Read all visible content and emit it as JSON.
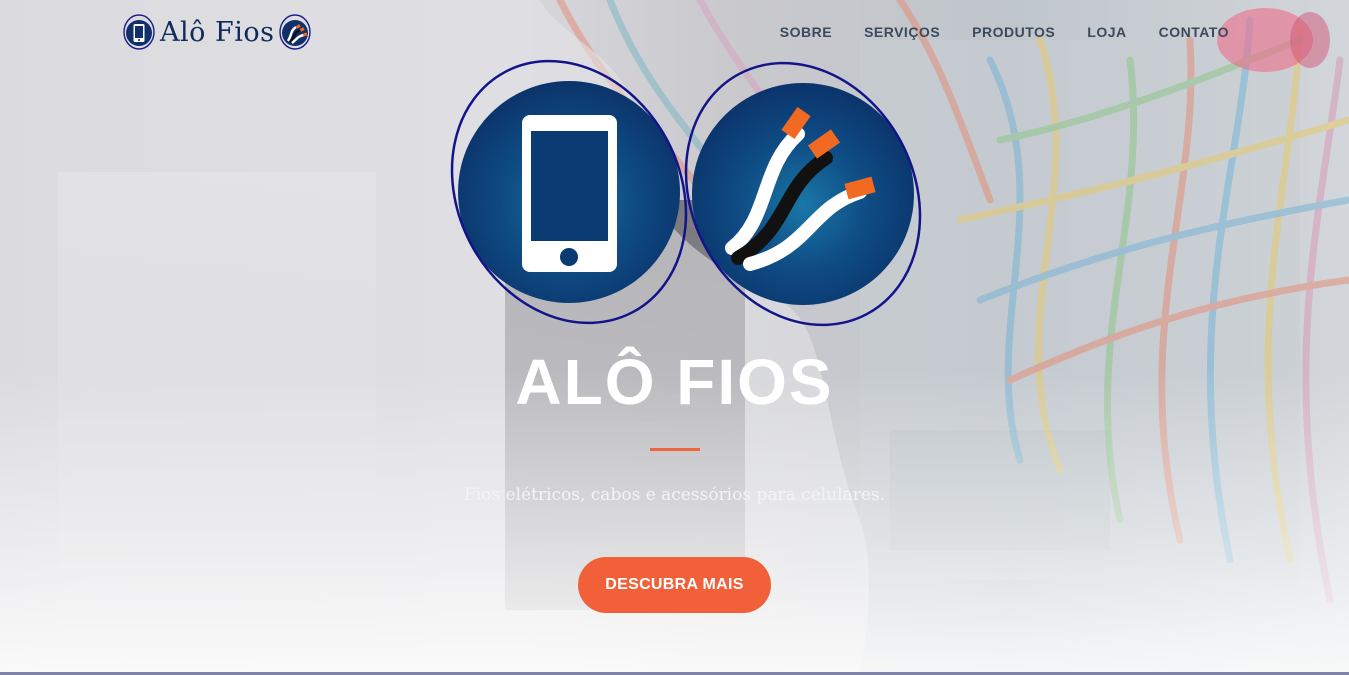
{
  "brand": {
    "logo_text": "Alô Fios",
    "left_icon": "phone-icon",
    "right_icon": "cable-icon"
  },
  "nav": {
    "items": [
      {
        "label": "SOBRE"
      },
      {
        "label": "SERVIÇOS"
      },
      {
        "label": "PRODUTOS"
      },
      {
        "label": "LOJA"
      },
      {
        "label": "CONTATO"
      }
    ]
  },
  "hero": {
    "badges": [
      "smartphone-icon",
      "wires-icon"
    ],
    "title": "ALÔ FIOS",
    "subtitle": "Fios elétricos, cabos e acessórios para celulares.",
    "cta_label": "DESCUBRA MAIS"
  },
  "colors": {
    "brand_navy": "#0f3068",
    "accent_orange": "#f2603a",
    "nav_text": "#3a4a5e",
    "orbit_ring": "#1a1a8c"
  }
}
